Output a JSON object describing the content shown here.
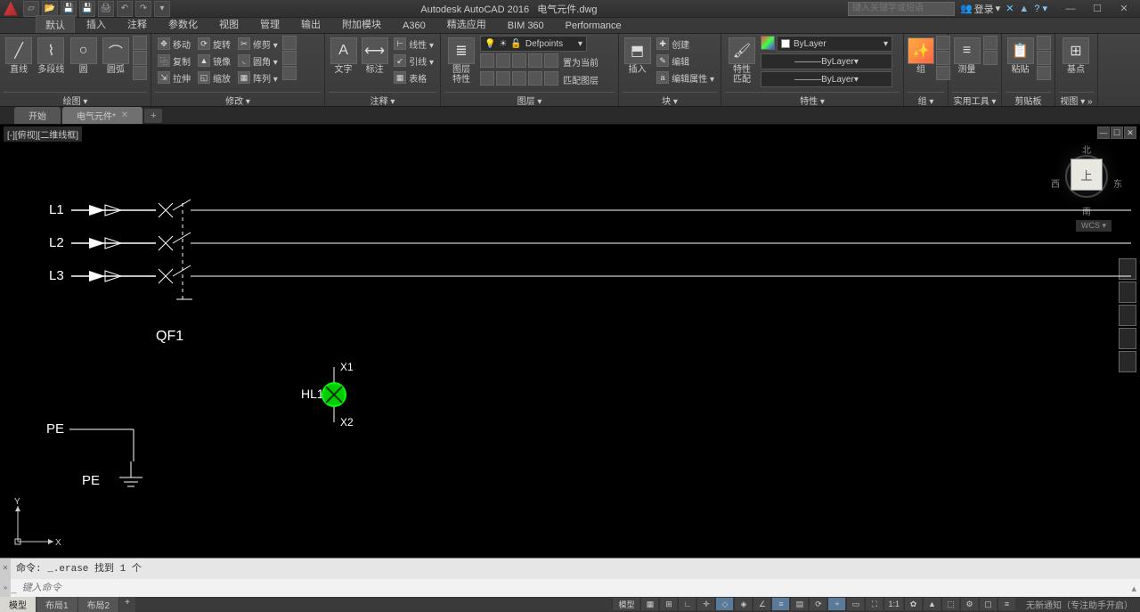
{
  "title": {
    "app": "Autodesk AutoCAD 2016",
    "file": "电气元件.dwg"
  },
  "qat_tips": [
    "new",
    "open",
    "save",
    "saveas",
    "plot",
    "undo",
    "redo"
  ],
  "search": {
    "placeholder": "键入关键字或短语"
  },
  "login": {
    "label": "登录"
  },
  "win": {
    "min": "—",
    "max": "☐",
    "close": "✕"
  },
  "ribbon_tabs": [
    "默认",
    "插入",
    "注释",
    "参数化",
    "视图",
    "管理",
    "输出",
    "附加模块",
    "A360",
    "精选应用",
    "BIM 360",
    "Performance"
  ],
  "active_ribbon_tab": 0,
  "panels": {
    "draw": {
      "title": "绘图 ▾",
      "line": "直线",
      "polyline": "多段线",
      "circle": "圆",
      "arc": "圆弧"
    },
    "modify": {
      "title": "修改 ▾",
      "move": "移动",
      "copy": "复制",
      "stretch": "拉伸",
      "rotate": "旋转",
      "mirror": "镜像",
      "scale": "缩放",
      "trim": "修剪 ▾",
      "fillet": "圆角 ▾ ",
      "array": "阵列 ▾"
    },
    "annot": {
      "title": "注释 ▾",
      "text": "文字",
      "dim": "标注",
      "leader": "引线 ▾",
      "table": "表格",
      "linear": "线性 ▾"
    },
    "layer": {
      "title": "图层 ▾",
      "props": "图层\n特性",
      "current": "Defpoints",
      "make_current": "置为当前",
      "match": "匹配图层"
    },
    "block": {
      "title": "块 ▾",
      "insert": "插入",
      "create": "创建",
      "edit": "编辑",
      "editattr": "编辑属性 ▾"
    },
    "props": {
      "title": "特性 ▾",
      "match": "特性\n匹配",
      "bylayer": "ByLayer"
    },
    "group": {
      "title": "组 ▾",
      "group": "组"
    },
    "util": {
      "title": "实用工具 ▾",
      "measure": "测量"
    },
    "clip": {
      "title": "剪贴板",
      "paste": "粘贴"
    },
    "view": {
      "title": "视图 ▾ »",
      "base": "基点"
    }
  },
  "doc_tabs": [
    {
      "label": "开始",
      "active": false
    },
    {
      "label": "电气元件*",
      "active": true
    }
  ],
  "viewport_label": "[-][俯视][二维线框]",
  "viewcube": {
    "n": "北",
    "s": "南",
    "w": "西",
    "e": "东",
    "top": "上",
    "wcs": "WCS ▾"
  },
  "drawing": {
    "L1": "L1",
    "L2": "L2",
    "L3": "L3",
    "QF1": "QF1",
    "PE": "PE",
    "HL1": "HL1",
    "X1": "X1",
    "X2": "X2"
  },
  "ucs": {
    "x": "X",
    "y": "Y"
  },
  "cmd": {
    "history": "命令: _.erase 找到 1 个",
    "placeholder": "键入命令"
  },
  "layout_tabs": [
    "模型",
    "布局1",
    "布局2"
  ],
  "active_layout": 0,
  "status": {
    "model": "模型",
    "scale": "1:1",
    "notif": "无新通知（专注助手开启）"
  }
}
